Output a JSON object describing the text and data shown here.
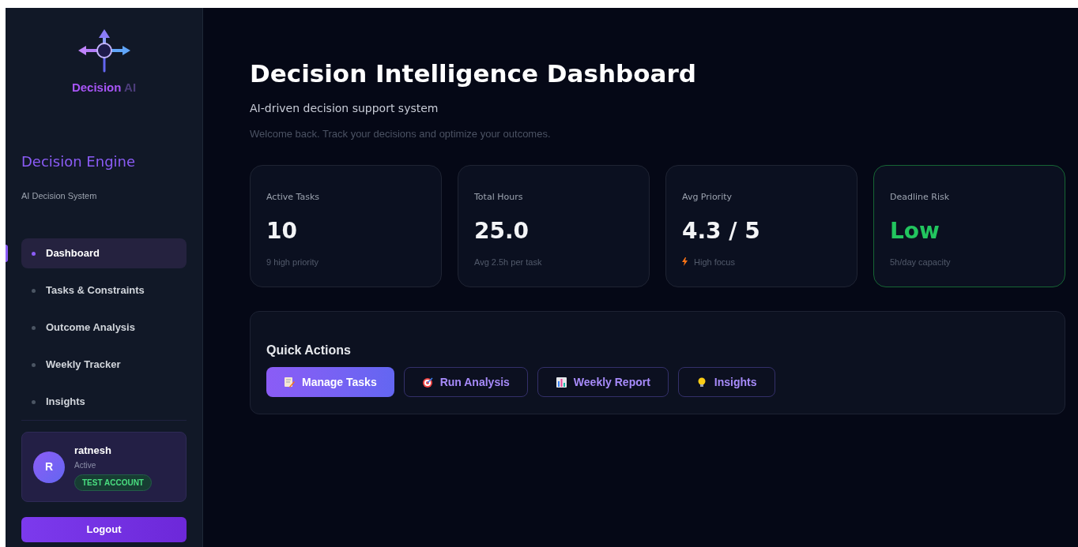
{
  "sidebar": {
    "logo": {
      "word": "Decision",
      "suffix": "AI"
    },
    "title": "Decision Engine",
    "subtitle": "AI Decision System",
    "nav": [
      {
        "label": "Dashboard",
        "selected": true
      },
      {
        "label": "Tasks & Constraints",
        "selected": false
      },
      {
        "label": "Outcome Analysis",
        "selected": false
      },
      {
        "label": "Weekly Tracker",
        "selected": false
      },
      {
        "label": "Insights",
        "selected": false
      }
    ],
    "user": {
      "initial": "R",
      "name": "ratnesh",
      "status": "Active",
      "badge": "TEST ACCOUNT"
    },
    "logout": "Logout"
  },
  "header": {
    "title": "Decision Intelligence Dashboard",
    "subtitle": "AI-driven decision support system",
    "welcome": "Welcome back. Track your decisions and optimize your outcomes."
  },
  "stats": [
    {
      "label": "Active Tasks",
      "value": "10",
      "note": "9 high priority",
      "kind": "plain"
    },
    {
      "label": "Total Hours",
      "value": "25.0",
      "note": "Avg 2.5h per task",
      "kind": "plain"
    },
    {
      "label": "Avg Priority",
      "value": "4.3 / 5",
      "note": "High focus",
      "kind": "bolt"
    },
    {
      "label": "Deadline Risk",
      "value": "Low",
      "note": "5h/day capacity",
      "kind": "good"
    }
  ],
  "quick_actions": {
    "title": "Quick Actions",
    "buttons": [
      {
        "label": "Manage Tasks",
        "selected": true
      },
      {
        "label": "Run Analysis",
        "selected": false
      },
      {
        "label": "Weekly Report",
        "selected": false
      },
      {
        "label": "Insights",
        "selected": false
      }
    ]
  }
}
